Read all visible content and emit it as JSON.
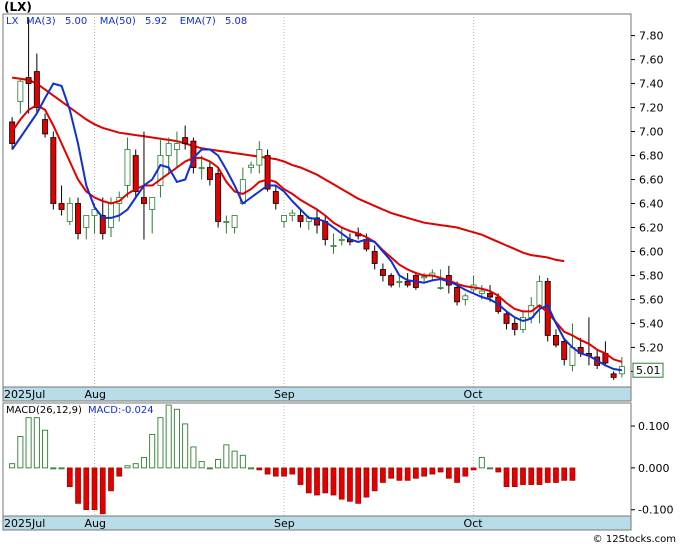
{
  "title": "(LX)",
  "footer": "© 12Stocks.com",
  "colors": {
    "up": "#ffffff",
    "up_stroke": "#2e7d32",
    "down": "#e00000",
    "ma3": "#1030d0",
    "ema": "#e00000",
    "hist_pos_stroke": "#2e7d32",
    "hist_neg": "#e00000",
    "axisbar": "#b8dce8"
  },
  "chart_data": [
    {
      "type": "candlestick",
      "ticker": "LX",
      "legend": [
        {
          "label": "MA(3)",
          "value": "5.00"
        },
        {
          "label": "MA(50)",
          "value": "5.92"
        },
        {
          "label": "EMA(7)",
          "value": "5.08"
        }
      ],
      "last_price_label": "5.01",
      "ylim": [
        4.87,
        7.98
      ],
      "y_ticks": [
        "7.80",
        "7.60",
        "7.40",
        "7.20",
        "7.00",
        "6.80",
        "6.60",
        "6.40",
        "6.20",
        "6.00",
        "5.80",
        "5.60",
        "5.40",
        "5.20",
        "5.00"
      ],
      "x_labels": [
        "2025Jul",
        "Aug",
        "Sep",
        "Oct"
      ],
      "candles": [
        [
          7.08,
          7.12,
          6.85,
          6.9
        ],
        [
          7.25,
          7.45,
          7.15,
          7.42
        ],
        [
          7.45,
          7.95,
          7.15,
          7.4
        ],
        [
          7.5,
          7.65,
          7.15,
          7.2
        ],
        [
          7.1,
          7.15,
          6.95,
          6.98
        ],
        [
          6.95,
          7.0,
          6.35,
          6.4
        ],
        [
          6.4,
          6.55,
          6.3,
          6.35
        ],
        [
          6.25,
          6.45,
          6.22,
          6.4
        ],
        [
          6.4,
          6.45,
          6.1,
          6.15
        ],
        [
          6.2,
          6.25,
          6.1,
          6.3
        ],
        [
          6.3,
          6.4,
          6.15,
          6.35
        ],
        [
          6.3,
          6.45,
          6.1,
          6.15
        ],
        [
          6.2,
          6.45,
          6.12,
          6.4
        ],
        [
          6.4,
          6.5,
          6.25,
          6.45
        ],
        [
          6.55,
          6.95,
          6.45,
          6.85
        ],
        [
          6.8,
          6.85,
          6.45,
          6.5
        ],
        [
          6.45,
          7.0,
          6.1,
          6.4
        ],
        [
          6.35,
          6.45,
          6.15,
          6.45
        ],
        [
          6.55,
          6.95,
          6.45,
          6.8
        ],
        [
          6.8,
          6.95,
          6.65,
          6.9
        ],
        [
          6.85,
          7.0,
          6.7,
          6.9
        ],
        [
          6.95,
          7.05,
          6.85,
          6.9
        ],
        [
          6.92,
          6.95,
          6.65,
          6.7
        ],
        [
          6.7,
          6.8,
          6.6,
          6.7
        ],
        [
          6.7,
          6.75,
          6.55,
          6.6
        ],
        [
          6.65,
          6.7,
          6.2,
          6.25
        ],
        [
          6.25,
          6.3,
          6.15,
          6.25
        ],
        [
          6.2,
          6.3,
          6.15,
          6.3
        ],
        [
          6.4,
          6.7,
          6.4,
          6.6
        ],
        [
          6.7,
          6.75,
          6.65,
          6.72
        ],
        [
          6.72,
          6.92,
          6.65,
          6.85
        ],
        [
          6.8,
          6.85,
          6.5,
          6.52
        ],
        [
          6.5,
          6.55,
          6.35,
          6.4
        ],
        [
          6.25,
          6.3,
          6.2,
          6.3
        ],
        [
          6.3,
          6.35,
          6.25,
          6.32
        ],
        [
          6.3,
          6.35,
          6.2,
          6.25
        ],
        [
          6.25,
          6.3,
          6.18,
          6.28
        ],
        [
          6.28,
          6.35,
          6.15,
          6.22
        ],
        [
          6.25,
          6.3,
          6.05,
          6.1
        ],
        [
          6.05,
          6.15,
          5.98,
          6.05
        ],
        [
          6.1,
          6.2,
          6.05,
          6.1
        ],
        [
          6.1,
          6.15,
          6.05,
          6.08
        ],
        [
          6.15,
          6.2,
          6.1,
          6.13
        ],
        [
          6.1,
          6.15,
          6.0,
          6.02
        ],
        [
          6.0,
          6.05,
          5.85,
          5.9
        ],
        [
          5.85,
          5.9,
          5.75,
          5.8
        ],
        [
          5.8,
          5.82,
          5.7,
          5.72
        ],
        [
          5.75,
          5.8,
          5.7,
          5.75
        ],
        [
          5.75,
          5.82,
          5.7,
          5.72
        ],
        [
          5.8,
          5.83,
          5.68,
          5.7
        ],
        [
          5.78,
          5.82,
          5.75,
          5.79
        ],
        [
          5.8,
          5.85,
          5.75,
          5.82
        ],
        [
          5.7,
          5.85,
          5.68,
          5.7
        ],
        [
          5.8,
          5.88,
          5.65,
          5.72
        ],
        [
          5.7,
          5.75,
          5.55,
          5.58
        ],
        [
          5.6,
          5.65,
          5.55,
          5.63
        ],
        [
          5.68,
          5.8,
          5.65,
          5.72
        ],
        [
          5.65,
          5.72,
          5.6,
          5.67
        ],
        [
          5.65,
          5.72,
          5.58,
          5.62
        ],
        [
          5.62,
          5.65,
          5.48,
          5.5
        ],
        [
          5.48,
          5.5,
          5.35,
          5.4
        ],
        [
          5.4,
          5.45,
          5.3,
          5.35
        ],
        [
          5.35,
          5.5,
          5.32,
          5.45
        ],
        [
          5.45,
          5.62,
          5.4,
          5.55
        ],
        [
          5.55,
          5.8,
          5.4,
          5.75
        ],
        [
          5.75,
          5.78,
          5.25,
          5.3
        ],
        [
          5.3,
          5.35,
          5.2,
          5.22
        ],
        [
          5.25,
          5.28,
          5.05,
          5.1
        ],
        [
          5.05,
          5.4,
          5.0,
          5.2
        ],
        [
          5.2,
          5.28,
          5.12,
          5.15
        ],
        [
          5.15,
          5.45,
          5.05,
          5.13
        ],
        [
          5.12,
          5.18,
          5.02,
          5.05
        ],
        [
          5.15,
          5.25,
          5.05,
          5.07
        ],
        [
          4.98,
          5.0,
          4.93,
          4.95
        ],
        [
          4.98,
          5.12,
          4.95,
          5.04
        ]
      ],
      "ma3_first_index": 0,
      "ma3": [
        6.85,
        6.95,
        7.05,
        7.15,
        7.28,
        7.4,
        7.38,
        7.18,
        6.9,
        6.55,
        6.37,
        6.28,
        6.28,
        6.3,
        6.35,
        6.45,
        6.55,
        6.6,
        6.72,
        6.7,
        6.58,
        6.6,
        6.78,
        6.85,
        6.85,
        6.8,
        6.68,
        6.55,
        6.4,
        6.45,
        6.5,
        6.55,
        6.55,
        6.5,
        6.42,
        6.35,
        6.28,
        6.27,
        6.25,
        6.2,
        6.15,
        6.1,
        6.08,
        6.1,
        6.08,
        6.0,
        5.92,
        5.8,
        5.76,
        5.75,
        5.74,
        5.76,
        5.77,
        5.75,
        5.72,
        5.68,
        5.65,
        5.62,
        5.6,
        5.56,
        5.5,
        5.45,
        5.42,
        5.44,
        5.52,
        5.55,
        5.4,
        5.27,
        5.2,
        5.15,
        5.13,
        5.09,
        5.05,
        5.02,
        5.01
      ],
      "ema7_first_index": 0,
      "ema7": [
        7.0,
        7.1,
        7.18,
        7.22,
        7.18,
        7.05,
        6.9,
        6.75,
        6.6,
        6.5,
        6.45,
        6.42,
        6.4,
        6.42,
        6.48,
        6.52,
        6.55,
        6.55,
        6.6,
        6.65,
        6.7,
        6.75,
        6.78,
        6.78,
        6.75,
        6.7,
        6.58,
        6.5,
        6.48,
        6.52,
        6.58,
        6.6,
        6.58,
        6.52,
        6.48,
        6.43,
        6.39,
        6.35,
        6.3,
        6.24,
        6.2,
        6.17,
        6.15,
        6.12,
        6.08,
        6.01,
        5.95,
        5.89,
        5.85,
        5.82,
        5.8,
        5.8,
        5.78,
        5.76,
        5.73,
        5.71,
        5.7,
        5.69,
        5.67,
        5.63,
        5.57,
        5.52,
        5.5,
        5.5,
        5.55,
        5.49,
        5.41,
        5.33,
        5.3,
        5.26,
        5.23,
        5.18,
        5.15,
        5.1,
        5.08
      ],
      "ma50_first_index": 0,
      "ma50": [
        7.45,
        7.44,
        7.43,
        7.4,
        7.35,
        7.3,
        7.25,
        7.2,
        7.15,
        7.1,
        7.06,
        7.03,
        7.01,
        6.99,
        6.98,
        6.97,
        6.96,
        6.95,
        6.94,
        6.93,
        6.92,
        6.9,
        6.88,
        6.86,
        6.85,
        6.84,
        6.83,
        6.82,
        6.81,
        6.8,
        6.79,
        6.78,
        6.77,
        6.75,
        6.72,
        6.7,
        6.67,
        6.64,
        6.6,
        6.56,
        6.52,
        6.48,
        6.44,
        6.41,
        6.38,
        6.35,
        6.32,
        6.3,
        6.28,
        6.26,
        6.24,
        6.23,
        6.22,
        6.21,
        6.2,
        6.18,
        6.16,
        6.14,
        6.11,
        6.08,
        6.05,
        6.02,
        5.99,
        5.97,
        5.96,
        5.95,
        5.93,
        5.92
      ],
      "x_label_index": {
        "2025Jul": 0,
        "Aug": 10,
        "Sep": 33,
        "Oct": 56
      }
    },
    {
      "type": "bar",
      "name": "MACD",
      "legend": [
        {
          "label": "MACD(26,12,9)"
        },
        {
          "label": "MACD:-0.024"
        }
      ],
      "ylim": [
        -0.115,
        0.155
      ],
      "y_ticks": [
        "0.100",
        "0.000",
        "-0.100"
      ],
      "x_labels": [
        "2025Jul",
        "Aug",
        "Sep",
        "Oct"
      ],
      "values": [
        0.01,
        0.075,
        0.12,
        0.12,
        0.09,
        0.0,
        0.0,
        -0.045,
        -0.085,
        -0.1,
        -0.1,
        -0.11,
        -0.055,
        -0.02,
        0.005,
        0.01,
        0.025,
        0.08,
        0.12,
        0.15,
        0.14,
        0.105,
        0.05,
        0.015,
        0.0,
        0.02,
        0.055,
        0.04,
        0.03,
        0.0,
        -0.005,
        -0.015,
        -0.02,
        -0.02,
        -0.015,
        -0.04,
        -0.06,
        -0.065,
        -0.06,
        -0.065,
        -0.075,
        -0.08,
        -0.085,
        -0.07,
        -0.055,
        -0.035,
        -0.025,
        -0.03,
        -0.03,
        -0.025,
        -0.02,
        -0.015,
        -0.01,
        -0.025,
        -0.035,
        -0.02,
        -0.005,
        0.025,
        0.0,
        -0.01,
        -0.045,
        -0.045,
        -0.04,
        -0.04,
        -0.04,
        -0.035,
        -0.035,
        -0.03,
        -0.03
      ]
    }
  ]
}
